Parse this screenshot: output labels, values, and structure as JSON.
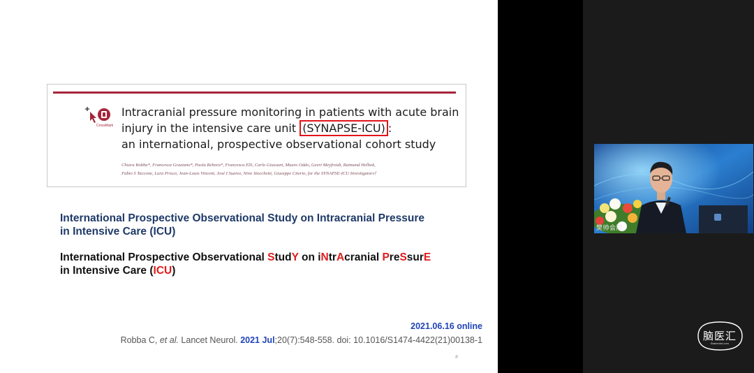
{
  "paper": {
    "crossmark_caption": "CrossMark",
    "title_line1": "Intracranial pressure monitoring in patients with acute brain",
    "title_line2_pre": "injury in the intensive care unit ",
    "title_line2_hl": "(SYNAPSE-ICU)",
    "title_line2_post": ":",
    "title_line3": "an international, prospective observational cohort study",
    "authors_line1": "Chiara Robba*, Francesca Graziano*, Paola Rebora*, Francesca Elli, Carlo Giussani, Mauro Oddo, Geert Meyfroidt, Raimund Helbok,",
    "authors_line2": "Fabio S Taccone, Lara Prisco, Jean-Louis Vincent, José I Suarez, Nino Stocchetti, Giuseppe Citerio, for the SYNAPSE-ICU Investigators†"
  },
  "acronym_plain": {
    "line1": "International Prospective Observational Study on Intracranial Pressure",
    "line2": "in Intensive Care (ICU)"
  },
  "acronym_highlight": {
    "segments_line1": [
      {
        "t": "International Prospective Observational ",
        "red": false
      },
      {
        "t": "S",
        "red": true
      },
      {
        "t": "tud",
        "red": false
      },
      {
        "t": "Y",
        "red": true
      },
      {
        "t": " on i",
        "red": false
      },
      {
        "t": "N",
        "red": true
      },
      {
        "t": "tr",
        "red": false
      },
      {
        "t": "A",
        "red": true
      },
      {
        "t": "cranial ",
        "red": false
      },
      {
        "t": "P",
        "red": true
      },
      {
        "t": "re",
        "red": false
      },
      {
        "t": "S",
        "red": true
      },
      {
        "t": "sur",
        "red": false
      },
      {
        "t": "E",
        "red": true
      }
    ],
    "segments_line2": [
      {
        "t": "in Intensive Care (",
        "red": false
      },
      {
        "t": "ICU",
        "red": true
      },
      {
        "t": ")",
        "red": false
      }
    ]
  },
  "citation": {
    "online": "2021.06.16 online",
    "authors": "Robba C, ",
    "etal": "et al.",
    "journal": " Lancet Neurol. ",
    "year": "2021 Jul",
    "rest": ";20(7):548-558. doi: 10.1016/S1474-4422(21)00138-1"
  },
  "slide_mark": "#",
  "video": {
    "label": "樊帅会院"
  },
  "logo": {
    "text": "脑医汇",
    "sub": "Brainmed.com"
  },
  "colors": {
    "accent_red": "#e01b1b",
    "title_blue": "#1f3a68",
    "link_blue": "#2144b8",
    "paper_rule": "#a6253b"
  }
}
